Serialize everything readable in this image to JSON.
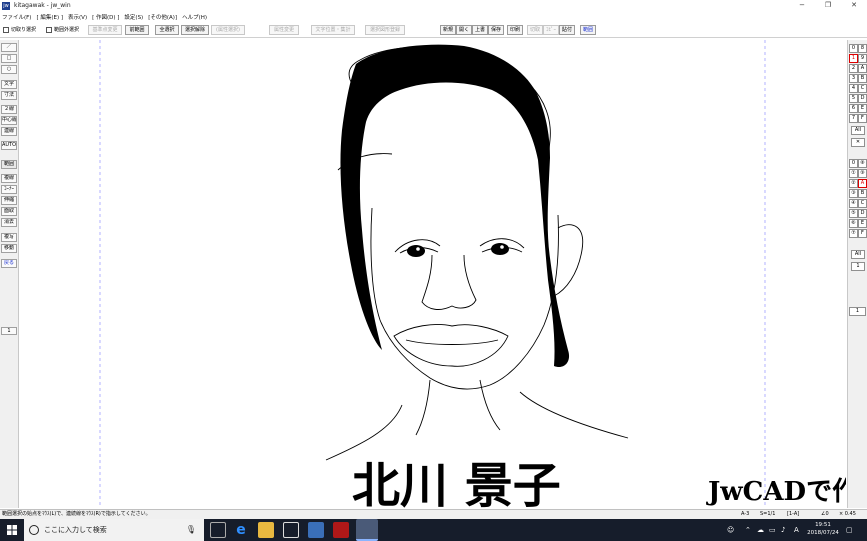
{
  "window": {
    "title": "kitagawak - jw_win",
    "app_icon": "jw",
    "controls": [
      "−",
      "❐",
      "✕"
    ]
  },
  "menu": [
    "ファイル(F)",
    "[ 編集(E) ]",
    "表示(V)",
    "[ 作図(D) ]",
    "設定(S)",
    "[その他(A)]",
    "ヘルプ(H)"
  ],
  "toolbar": {
    "check_cut": "切取り選択",
    "check_outside": "範囲外選択",
    "btn_base_change": "基準点変更",
    "btn_prev_range": "前範囲",
    "btn_select_all": "全選択",
    "btn_deselect": "選択解除",
    "btn_attr_select": "(属性選択)",
    "btn_attr_change": "属性変更",
    "btn_text_pos": "文字位置・集計",
    "btn_select_save": "選択図形登録",
    "btn_new": "新規",
    "btn_open": "開く",
    "btn_overwrite": "上書",
    "btn_save": "保存",
    "btn_print": "印刷",
    "btn_cut": "切取",
    "btn_copy": "ｺﾋﾟｰ",
    "btn_paste": "貼付",
    "btn_range": "範囲"
  },
  "left_tools": [
    "／",
    "□",
    "○",
    "文字",
    "寸法",
    "２線",
    "中心線",
    "連線",
    "AUTO",
    "範囲",
    "複線",
    "ｺｰﾅｰ",
    "伸縮",
    "面取",
    "消去",
    "複写",
    "移動",
    "戻る",
    "1"
  ],
  "right_layers": {
    "group_rows": [
      [
        "0",
        "8"
      ],
      [
        "1",
        "9"
      ],
      [
        "2",
        "A"
      ],
      [
        "3",
        "B"
      ],
      [
        "4",
        "C"
      ],
      [
        "5",
        "D"
      ],
      [
        "6",
        "E"
      ],
      [
        "7",
        "F"
      ]
    ],
    "group_all": "All",
    "group_x": "✕",
    "layer_rows": [
      [
        "0",
        "⑧"
      ],
      [
        "①",
        "⑨"
      ],
      [
        "②",
        "A"
      ],
      [
        "③",
        "B"
      ],
      [
        "④",
        "C"
      ],
      [
        "⑤",
        "D"
      ],
      [
        "⑥",
        "E"
      ],
      [
        "⑦",
        "F"
      ]
    ],
    "layer_all": "All",
    "layer_num": "1",
    "side_num": "1"
  },
  "drawing": {
    "name": "北川 景子",
    "tagline": "JwCADで作図"
  },
  "status": {
    "message": "範囲選択の始点をﾏｳｽ(L)で、連続線をﾏｳｽ(R)で指示してください。",
    "paper": "A-3",
    "scale": "S=1/1",
    "layer": "[1-A]",
    "angle": "∠0",
    "zoom": "× 0.45"
  },
  "taskbar": {
    "search_placeholder": "ここに入力して検索",
    "time": "19:51",
    "date": "2018/07/24",
    "ime": "A"
  },
  "colors": {
    "taskbar_bg": "#161d2b",
    "accent_blue": "#1a2fd0",
    "accent_red": "#d00000"
  }
}
